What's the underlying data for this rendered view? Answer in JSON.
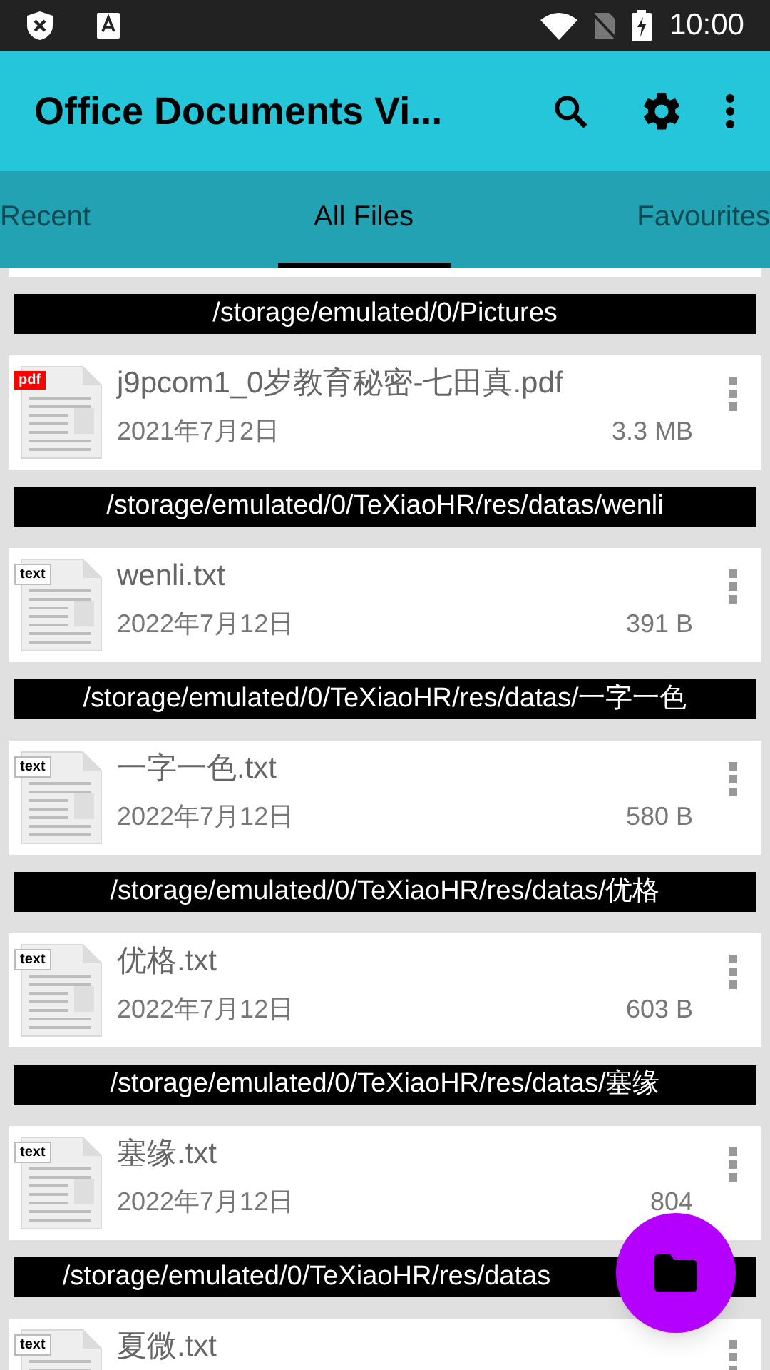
{
  "status_bar": {
    "time": "10:00"
  },
  "app_bar": {
    "title": "Office Documents Vi..."
  },
  "tabs": [
    {
      "label": "Recent",
      "selected": false
    },
    {
      "label": "All Files",
      "selected": true
    },
    {
      "label": "Favourites",
      "selected": false
    }
  ],
  "sections": [
    {
      "path": "/storage/emulated/0/Pictures",
      "files": [
        {
          "kind": "pdf",
          "badge": "pdf",
          "name": "j9pcom1_0岁教育秘密-七田真.pdf",
          "date": "2021年7月2日",
          "size": "3.3 MB"
        }
      ]
    },
    {
      "path": "/storage/emulated/0/TeXiaoHR/res/datas/wenli",
      "files": [
        {
          "kind": "text",
          "badge": "text",
          "name": "wenli.txt",
          "date": "2022年7月12日",
          "size": "391 B"
        }
      ]
    },
    {
      "path": "/storage/emulated/0/TeXiaoHR/res/datas/一字一色",
      "files": [
        {
          "kind": "text",
          "badge": "text",
          "name": "一字一色.txt",
          "date": "2022年7月12日",
          "size": "580 B"
        }
      ]
    },
    {
      "path": "/storage/emulated/0/TeXiaoHR/res/datas/优格",
      "files": [
        {
          "kind": "text",
          "badge": "text",
          "name": "优格.txt",
          "date": "2022年7月12日",
          "size": "603 B"
        }
      ]
    },
    {
      "path": "/storage/emulated/0/TeXiaoHR/res/datas/塞缘",
      "files": [
        {
          "kind": "text",
          "badge": "text",
          "name": "塞缘.txt",
          "date": "2022年7月12日",
          "size": "804"
        }
      ]
    },
    {
      "path": "/storage/emulated/0/TeXiaoHR/res/datas",
      "files": [
        {
          "kind": "text",
          "badge": "text",
          "name": "夏微.txt"
        }
      ]
    }
  ]
}
